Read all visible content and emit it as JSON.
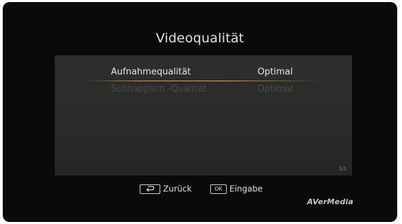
{
  "screen": {
    "title": "Videoqualität"
  },
  "menu": {
    "items": [
      {
        "label": "Aufnahmequalität",
        "value": "Optimal",
        "state": "selected"
      },
      {
        "label": "Schnappsch.-Qualität",
        "value": "Optimal",
        "state": "disabled"
      }
    ],
    "page_indicator": "1/1"
  },
  "hints": {
    "back_label": "Zurück",
    "ok_key": "OK",
    "ok_label": "Eingabe"
  },
  "brand": {
    "logo_text": "AVerMedia"
  },
  "colors": {
    "background": "#0a0a0a",
    "panel": "#2c2c2a",
    "highlight_line": "#d6a03a",
    "text": "#e8e8e8",
    "disabled_text": "#4a4a47"
  },
  "icons": {
    "back": "back-arrow-icon"
  }
}
